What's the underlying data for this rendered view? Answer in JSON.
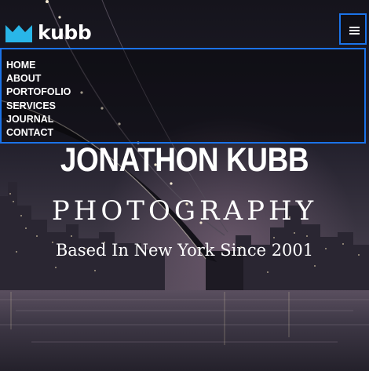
{
  "brand": {
    "logo_text": "kubb",
    "logo_icon": "crown-icon",
    "accent_color": "#29b6e8"
  },
  "header": {
    "menu_toggle_icon": "hamburger-menu-icon",
    "focus_outline_color": "#1b73e8"
  },
  "nav": {
    "items": [
      {
        "label": "HOME"
      },
      {
        "label": "ABOUT"
      },
      {
        "label": "PORTOFOLIO"
      },
      {
        "label": "SERVICES"
      },
      {
        "label": "JOURNAL"
      },
      {
        "label": "CONTACT"
      }
    ]
  },
  "hero": {
    "name": "JONATHON KUBB",
    "subtitle": "PHOTOGRAPHY",
    "tagline": "Based In New York Since 2001",
    "background": "night-city-bridge-photo"
  }
}
